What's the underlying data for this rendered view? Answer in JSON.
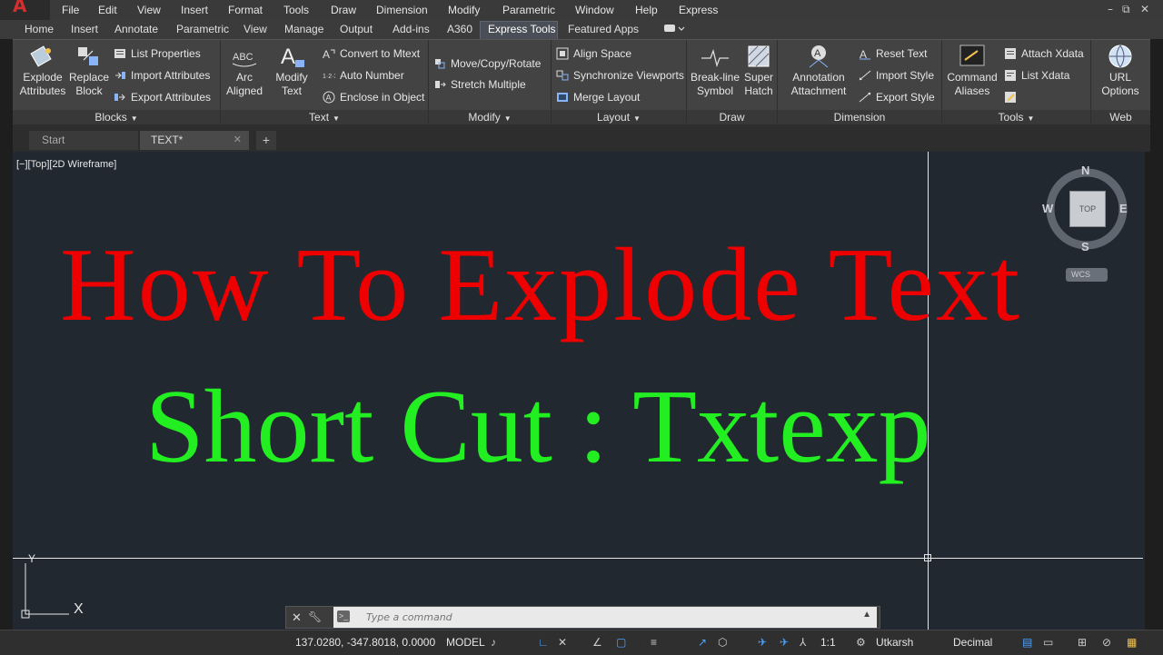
{
  "menubar": {
    "items": [
      "File",
      "Edit",
      "View",
      "Insert",
      "Format",
      "Tools",
      "Draw",
      "Dimension",
      "Modify",
      "Parametric",
      "Window",
      "Help",
      "Express"
    ],
    "window_controls": [
      "–",
      "⧉",
      "✕"
    ]
  },
  "ribbon_tabs": [
    "Home",
    "Insert",
    "Annotate",
    "Parametric",
    "View",
    "Manage",
    "Output",
    "Add-ins",
    "A360",
    "Express Tools",
    "Featured Apps"
  ],
  "active_tab": "Express Tools",
  "panels": {
    "blocks": {
      "title": "Blocks",
      "explode_attributes": [
        "Explode",
        "Attributes"
      ],
      "replace_block": [
        "Replace",
        "Block"
      ],
      "list_properties": "List Properties",
      "import_attributes": "Import Attributes",
      "export_attributes": "Export Attributes"
    },
    "text": {
      "title": "Text",
      "arc_aligned": [
        "Arc",
        "Aligned"
      ],
      "modify_text": [
        "Modify",
        "Text"
      ],
      "arc_icon_text": "ABC",
      "convert_to_mtext": "Convert to Mtext",
      "auto_number": "Auto Number",
      "enclose_in_object": "Enclose in Object"
    },
    "modify": {
      "title": "Modify",
      "move_copy_rotate": "Move/Copy/Rotate",
      "stretch_multiple": "Stretch Multiple"
    },
    "layout": {
      "title": "Layout",
      "align_space": "Align Space",
      "synchronize_viewports": "Synchronize Viewports",
      "merge_layout": "Merge Layout"
    },
    "draw": {
      "title": "Draw",
      "break_line_symbol": [
        "Break-line",
        "Symbol"
      ],
      "super_hatch": [
        "Super",
        "Hatch"
      ]
    },
    "dimension": {
      "title": "Dimension",
      "annotation_attachment": [
        "Annotation",
        "Attachment"
      ],
      "reset_text": "Reset Text",
      "import_style": "Import Style",
      "export_style": "Export Style"
    },
    "tools": {
      "title": "Tools",
      "command_aliases": [
        "Command",
        "Aliases"
      ],
      "attach_xdata": "Attach Xdata",
      "list_xdata": "List Xdata"
    },
    "web": {
      "title": "Web",
      "url_options": [
        "URL",
        "Options"
      ]
    }
  },
  "file_tabs": {
    "start": "Start",
    "current": "TEXT*",
    "close": "✕",
    "new": "+"
  },
  "viewport": {
    "label": "[−][Top][2D Wireframe]",
    "title_text": "How To Explode Text",
    "subtitle_text": "Short Cut : Txtexp",
    "title_color": "#ee0000",
    "subtitle_color": "#22ee22",
    "background": "#212830"
  },
  "viewcube": {
    "n": "N",
    "s": "S",
    "e": "E",
    "w": "W",
    "top": "TOP",
    "wcs": "WCS"
  },
  "ucs": {
    "y": "Y",
    "x": "X"
  },
  "command_line": {
    "placeholder": "Type a command"
  },
  "statusbar": {
    "coordinates": "137.0280, -347.8018, 0.0000",
    "model": "MODEL",
    "scale": "1:1",
    "workspace": "Utkarsh",
    "units": "Decimal"
  }
}
